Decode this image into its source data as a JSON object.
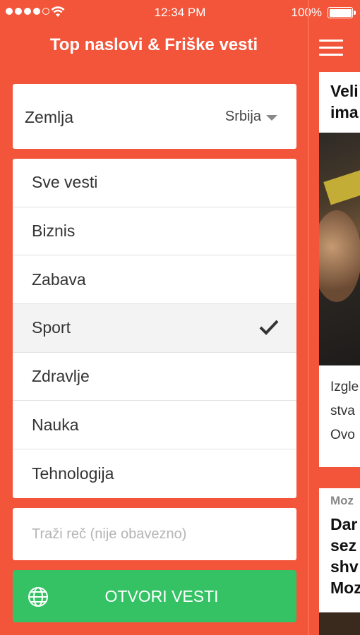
{
  "status_bar": {
    "time": "12:34 PM",
    "battery": "100%"
  },
  "header": {
    "title": "Top naslovi & Friške vesti",
    "menu_icon": "hamburger-menu-icon"
  },
  "country": {
    "label": "Zemlja",
    "value": "Srbija"
  },
  "categories": [
    {
      "label": "Sve vesti",
      "selected": false
    },
    {
      "label": "Biznis",
      "selected": false
    },
    {
      "label": "Zabava",
      "selected": false
    },
    {
      "label": "Sport",
      "selected": true
    },
    {
      "label": "Zdravlje",
      "selected": false
    },
    {
      "label": "Nauka",
      "selected": false
    },
    {
      "label": "Tehnologija",
      "selected": false
    }
  ],
  "search": {
    "placeholder": "Traži reč (nije obavezno)",
    "value": ""
  },
  "open_button": {
    "label": "OTVORI VESTI",
    "icon": "globe-icon"
  },
  "preview": {
    "title": "Veli ima",
    "text": "Izgle stva Ovo"
  },
  "preview2": {
    "source": "Moz",
    "title": "Dar sez shv Moz"
  },
  "colors": {
    "background": "#f2553a",
    "button": "#35c264"
  }
}
